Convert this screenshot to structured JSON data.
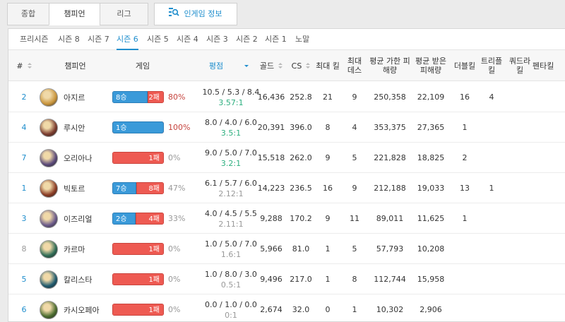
{
  "top_tabs": [
    {
      "label": "종합"
    },
    {
      "label": "챔피언"
    },
    {
      "label": "리그"
    },
    {
      "label": "인게임 정보"
    }
  ],
  "seasons": [
    "프리시즌",
    "시즌 8",
    "시즌 7",
    "시즌 6",
    "시즌 5",
    "시즌 4",
    "시즌 3",
    "시즌 2",
    "시즌 1",
    "노말"
  ],
  "active_season": "시즌 6",
  "headers": {
    "rank": "#",
    "champion": "챔피언",
    "games": "게임",
    "rating": "평점",
    "gold": "골드",
    "cs": "CS",
    "max_kill": "최대 킬",
    "max_death": "최대 데스",
    "avg_dmg_dealt": "평균 가한 피해량",
    "avg_dmg_taken": "평균 받은 피해량",
    "double_kill": "더블킬",
    "triple_kill": "트리플 킬",
    "quadra_kill": "쿼드라 킬",
    "penta_kill": "펜타킬"
  },
  "rows": [
    {
      "rank": "2",
      "champion": "아지르",
      "wins_label": "8승",
      "losses_label": "2패",
      "win_frac": 0.8,
      "winrate": "80%",
      "kda": "10.5 / 5.3 / 8.4",
      "ratio": "3.57:1",
      "gold": "16,436",
      "cs": "252.8",
      "max_kill": "21",
      "max_death": "9",
      "dmg_dealt": "250,358",
      "dmg_taken": "22,109",
      "double": "16",
      "triple": "4",
      "quadra": "",
      "penta": "",
      "avatar_color": "#c9953c"
    },
    {
      "rank": "4",
      "champion": "루시안",
      "wins_label": "1승",
      "losses_label": "",
      "win_frac": 1.0,
      "winrate": "100%",
      "kda": "8.0 / 4.0 / 6.0",
      "ratio": "3.5:1",
      "gold": "20,391",
      "cs": "396.0",
      "max_kill": "8",
      "max_death": "4",
      "dmg_dealt": "353,375",
      "dmg_taken": "27,365",
      "double": "1",
      "triple": "",
      "quadra": "",
      "penta": "",
      "avatar_color": "#7a3b2e"
    },
    {
      "rank": "7",
      "champion": "오리아나",
      "wins_label": "",
      "losses_label": "1패",
      "win_frac": 0.0,
      "winrate": "0%",
      "kda": "9.0 / 5.0 / 7.0",
      "ratio": "3.2:1",
      "gold": "15,518",
      "cs": "262.0",
      "max_kill": "9",
      "max_death": "5",
      "dmg_dealt": "221,828",
      "dmg_taken": "18,825",
      "double": "2",
      "triple": "",
      "quadra": "",
      "penta": "",
      "avatar_color": "#5b4a7a"
    },
    {
      "rank": "1",
      "champion": "빅토르",
      "wins_label": "7승",
      "losses_label": "8패",
      "win_frac": 0.47,
      "winrate": "47%",
      "kda": "6.1 / 5.7 / 6.0",
      "ratio": "2.12:1",
      "gold": "14,223",
      "cs": "236.5",
      "max_kill": "16",
      "max_death": "9",
      "dmg_dealt": "212,188",
      "dmg_taken": "19,033",
      "double": "13",
      "triple": "1",
      "quadra": "",
      "penta": "",
      "avatar_color": "#8a3b24"
    },
    {
      "rank": "3",
      "champion": "이즈리얼",
      "wins_label": "2승",
      "losses_label": "4패",
      "win_frac": 0.33,
      "winrate": "33%",
      "kda": "4.0 / 4.5 / 5.5",
      "ratio": "2.11:1",
      "gold": "9,288",
      "cs": "170.2",
      "max_kill": "9",
      "max_death": "11",
      "dmg_dealt": "89,011",
      "dmg_taken": "11,625",
      "double": "1",
      "triple": "",
      "quadra": "",
      "penta": "",
      "avatar_color": "#6b5a8a"
    },
    {
      "rank": "8",
      "champion": "카르마",
      "wins_label": "",
      "losses_label": "1패",
      "win_frac": 0.0,
      "winrate": "0%",
      "kda": "1.0 / 5.0 / 7.0",
      "ratio": "1.6:1",
      "gold": "5,966",
      "cs": "81.0",
      "max_kill": "1",
      "max_death": "5",
      "dmg_dealt": "57,793",
      "dmg_taken": "10,208",
      "double": "",
      "triple": "",
      "quadra": "",
      "penta": "",
      "avatar_color": "#2e6b55"
    },
    {
      "rank": "5",
      "champion": "칼리스타",
      "wins_label": "",
      "losses_label": "1패",
      "win_frac": 0.0,
      "winrate": "0%",
      "kda": "1.0 / 8.0 / 3.0",
      "ratio": "0.5:1",
      "gold": "9,496",
      "cs": "217.0",
      "max_kill": "1",
      "max_death": "8",
      "dmg_dealt": "112,744",
      "dmg_taken": "15,958",
      "double": "",
      "triple": "",
      "quadra": "",
      "penta": "",
      "avatar_color": "#1f5a6e"
    },
    {
      "rank": "6",
      "champion": "카시오페아",
      "wins_label": "",
      "losses_label": "1패",
      "win_frac": 0.0,
      "winrate": "0%",
      "kda": "0.0 / 1.0 / 0.0",
      "ratio": "0:1",
      "gold": "2,674",
      "cs": "32.0",
      "max_kill": "0",
      "max_death": "1",
      "dmg_dealt": "10,302",
      "dmg_taken": "2,906",
      "double": "",
      "triple": "",
      "quadra": "",
      "penta": "",
      "avatar_color": "#4a6b2e"
    }
  ],
  "colors": {
    "win": "#3a9ad9",
    "loss": "#ee5a52",
    "accent": "#1f8ecd",
    "hot": "#c6443e",
    "good_ratio": "#2daf7f"
  }
}
